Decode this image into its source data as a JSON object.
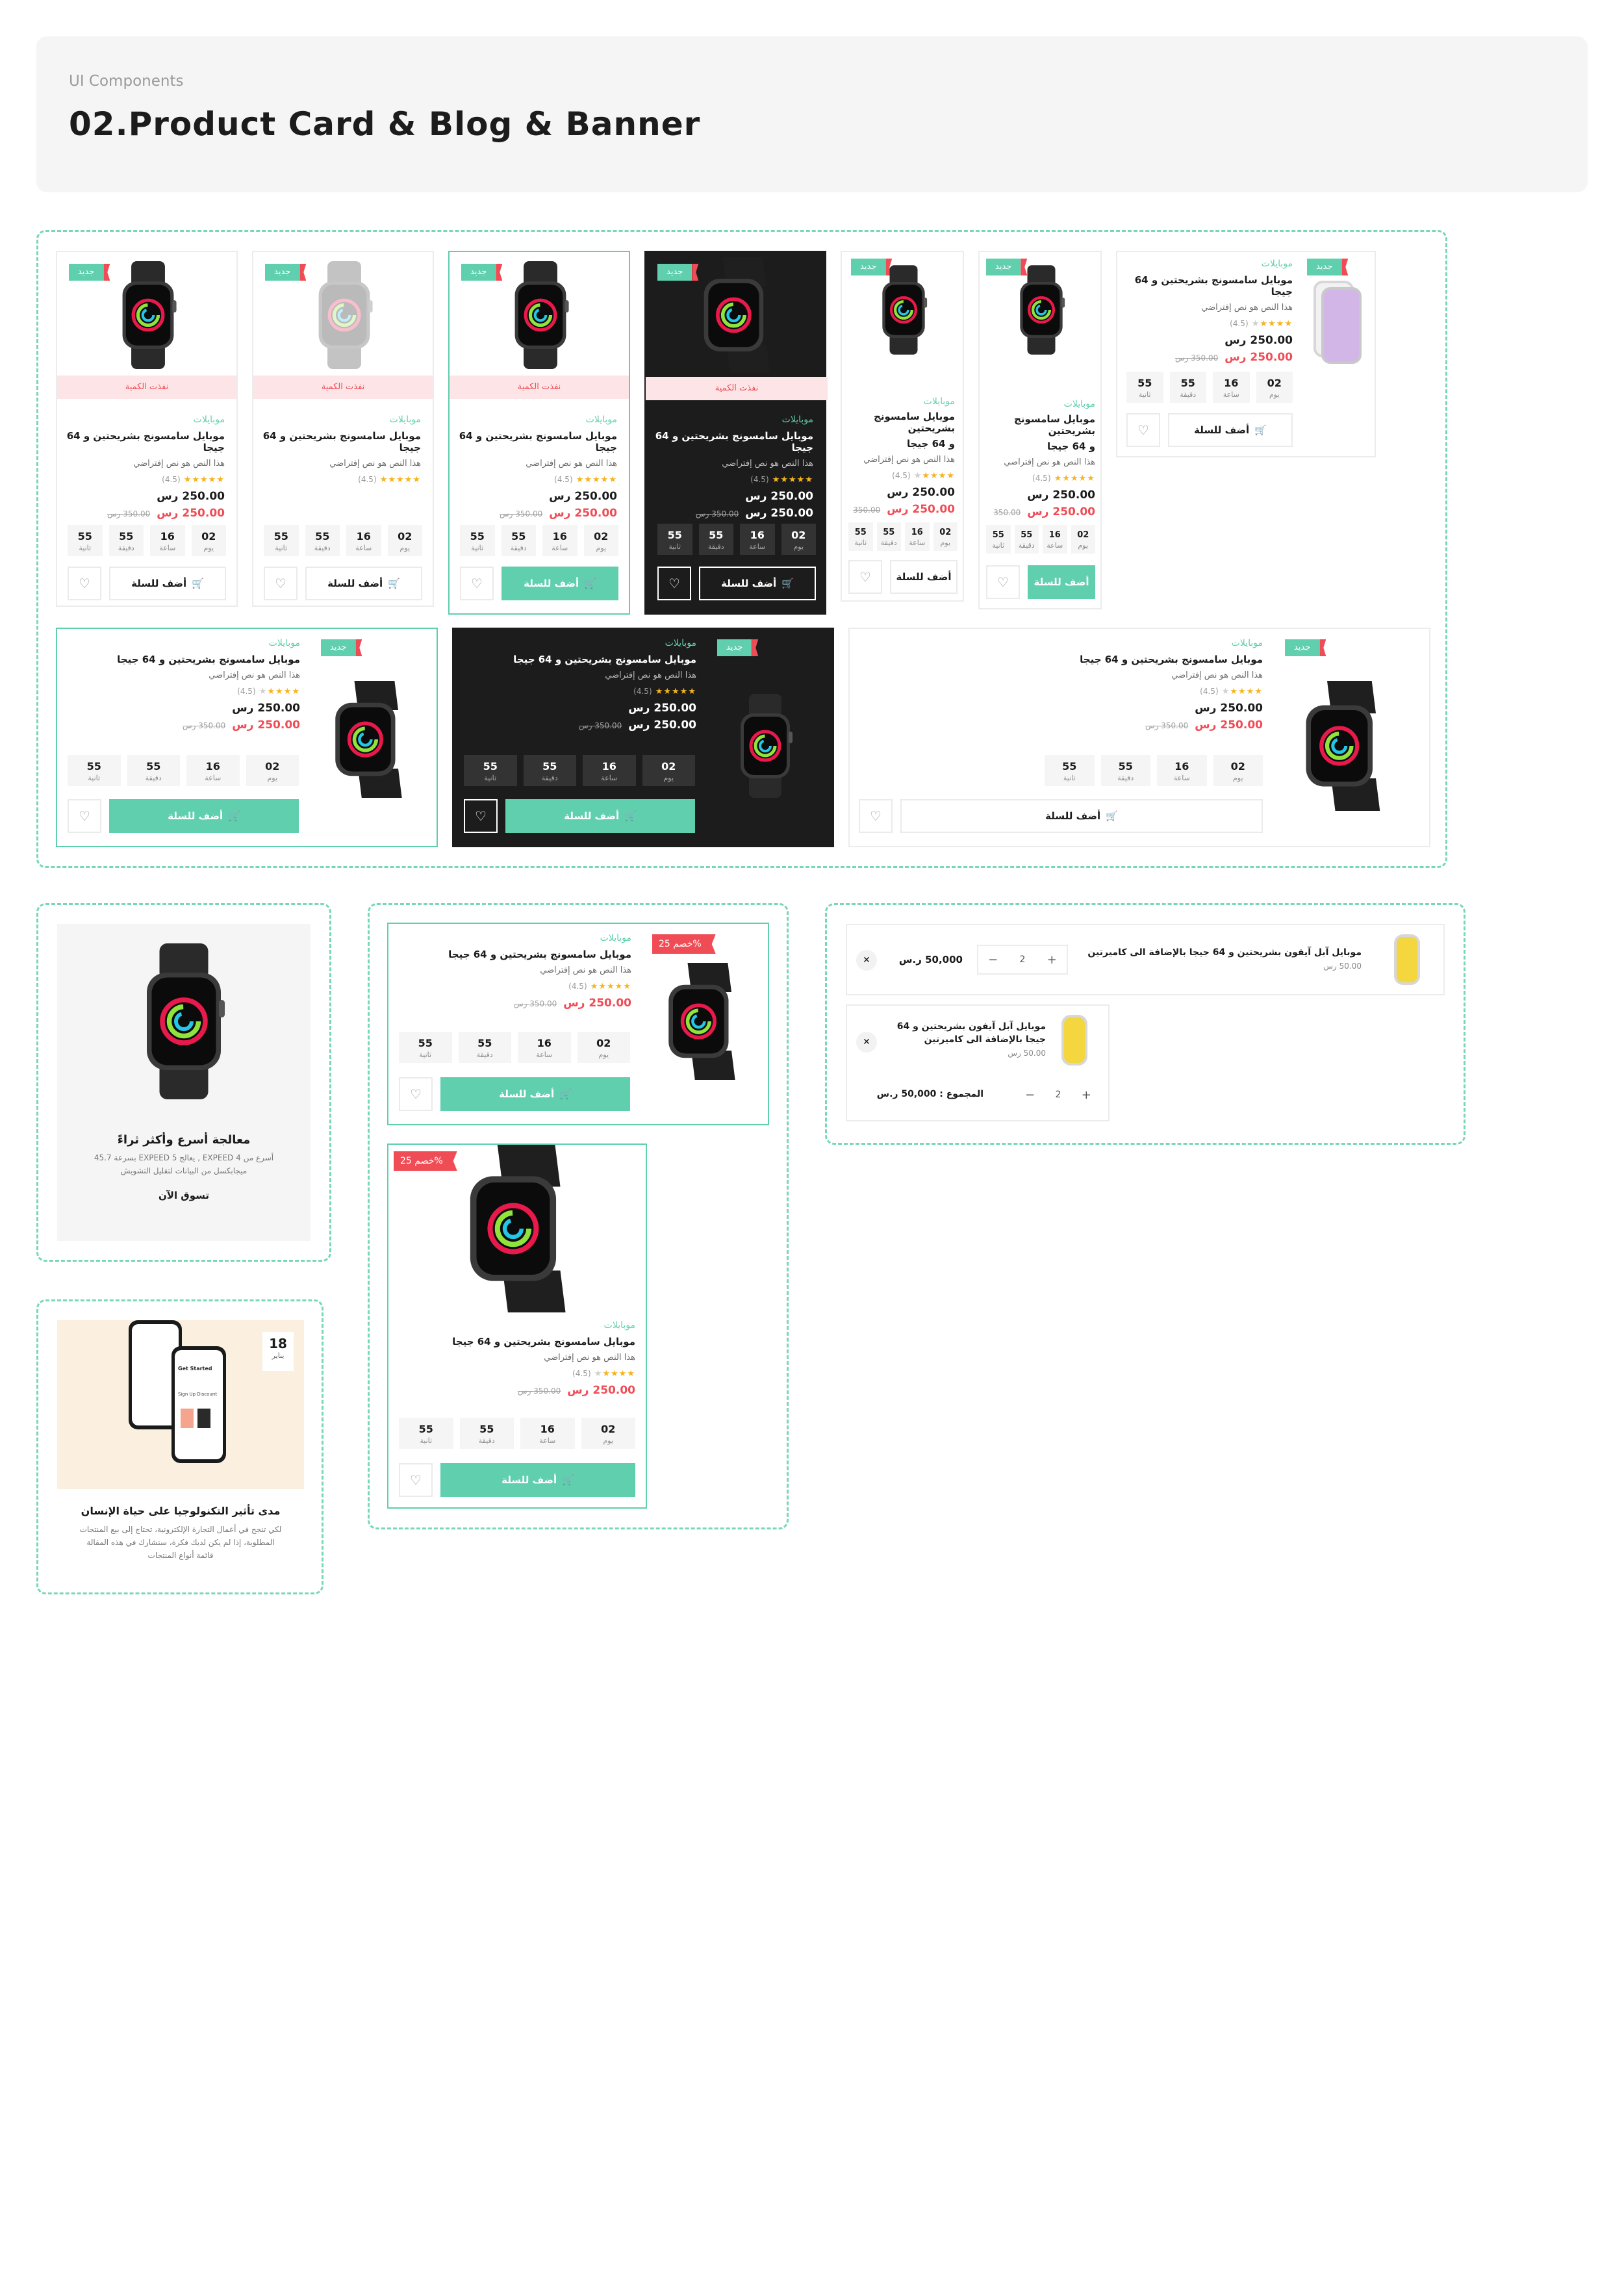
{
  "header": {
    "kicker": "UI Components",
    "title": "02.Product Card & Blog & Banner"
  },
  "product": {
    "category": "موبايلات",
    "title": "موبايل سامسونج بشريحتين و 64 جيجا",
    "title_line1": "موبايل سامسونج بشريحتين",
    "title_line2": "و 64 جيجا",
    "desc": "هذا النص هو نص إفتراضي",
    "rating": "(4.5)",
    "price": "250.00 رس",
    "sale_price": "250.00 رس",
    "old_price": "350.00 رس",
    "tag_new": "جديد",
    "sold_out": "نفذت الكمية",
    "discount": "خصم 25%",
    "add_to_cart": "أضف للسلة"
  },
  "countdown": [
    {
      "value": "02",
      "label": "يوم"
    },
    {
      "value": "16",
      "label": "ساعة"
    },
    {
      "value": "55",
      "label": "دقيقة"
    },
    {
      "value": "55",
      "label": "ثانية"
    }
  ],
  "banner": {
    "title": "معالجة أسرع وأكثر ثراءً",
    "desc_line1": "أسرع من EXPEED 4 , يعالج EXPEED 5 بسرعة 45.7",
    "desc_line2": "ميجابكسل من البيانات لتقليل التشويش",
    "cta": "تسوق الآن"
  },
  "blog": {
    "day": "18",
    "month": "يناير",
    "title": "مدى تأثير التكنولوجيا على حياة الإنسان",
    "desc_line1": "لكي تنجح في أعمال التجارة الإلكترونية، تحتاج إلى بيع المنتجات",
    "desc_line2": "المطلوبة، إذا لم يكن لديك فكرة، سنشارك في هذه المقالة",
    "desc_line3": "قائمة أنواع المنتجات",
    "phone_texts": [
      "Get Started",
      "Sign Up Discount",
      "Shop Now"
    ]
  },
  "cart": {
    "item1_title": "موبايل  آبل آيفون بشريحتين و 64 جيجا بالإضافة الى كاميرتين",
    "item1_price": "50.00 رس",
    "item1_total": "50,000 ر.س",
    "qty": "2",
    "item2_title_line1": "موبايل  آبل آيفون بشريحتين و 64",
    "item2_title_line2": "جيجا بالإضافة الى كاميرتين",
    "item2_price": "50.00 رس",
    "total_label": "المجموع : 50,000 ر.س"
  },
  "icons": {
    "heart": "heart-icon",
    "cart": "cart-icon",
    "close": "close-icon",
    "plus": "plus-icon",
    "minus": "minus-icon"
  },
  "colors": {
    "accent": "#5fcfae",
    "sale": "#f04c55",
    "dark": "#1c1c1c",
    "star": "#f5b41f"
  }
}
